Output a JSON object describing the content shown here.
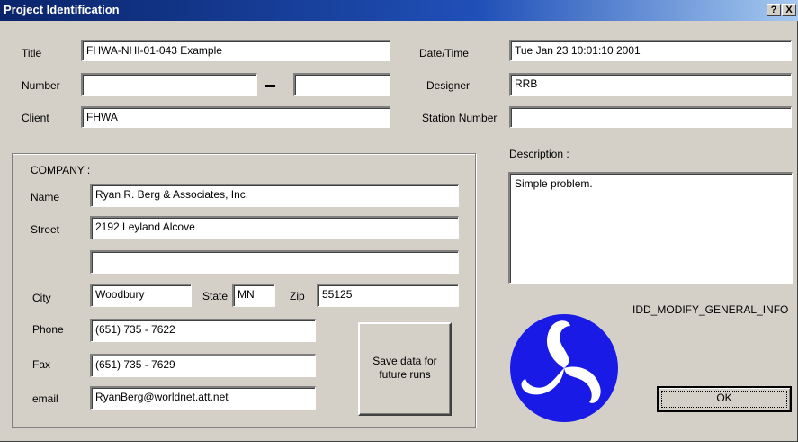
{
  "window": {
    "title": "Project Identification",
    "help_label": "?",
    "close_label": "X"
  },
  "fields": {
    "title": {
      "label": "Title",
      "value": "FHWA-NHI-01-043 Example"
    },
    "number": {
      "label": "Number",
      "value1": "",
      "value2": ""
    },
    "client": {
      "label": "Client",
      "value": "FHWA"
    },
    "datetime": {
      "label": "Date/Time",
      "value": "Tue Jan 23 10:01:10 2001"
    },
    "designer": {
      "label": "Designer",
      "value": "RRB"
    },
    "station": {
      "label": "Station Number",
      "value": ""
    }
  },
  "description": {
    "label": "Description :",
    "value": "Simple problem."
  },
  "company": {
    "group_label": "COMPANY :",
    "name": {
      "label": "Name",
      "value": "Ryan R. Berg & Associates, Inc."
    },
    "street": {
      "label": "Street",
      "value": "2192 Leyland Alcove",
      "value2": ""
    },
    "city": {
      "label": "City",
      "value": "Woodbury"
    },
    "state": {
      "label": "State",
      "value": "MN"
    },
    "zip": {
      "label": "Zip",
      "value": "55125"
    },
    "phone": {
      "label": "Phone",
      "value": "(651) 735 - 7622"
    },
    "fax": {
      "label": "Fax",
      "value": "(651) 735 - 7629"
    },
    "email": {
      "label": "email",
      "value": "RyanBerg@worldnet.att.net"
    }
  },
  "buttons": {
    "save_line1": "Save data for",
    "save_line2": "future runs",
    "ok": "OK"
  },
  "resource_id": "IDD_MODIFY_GENERAL_INFO",
  "colors": {
    "logo_blue": "#1a1ae6",
    "titlebar_start": "#0a246a",
    "dialog_bg": "#d4d0c8"
  }
}
